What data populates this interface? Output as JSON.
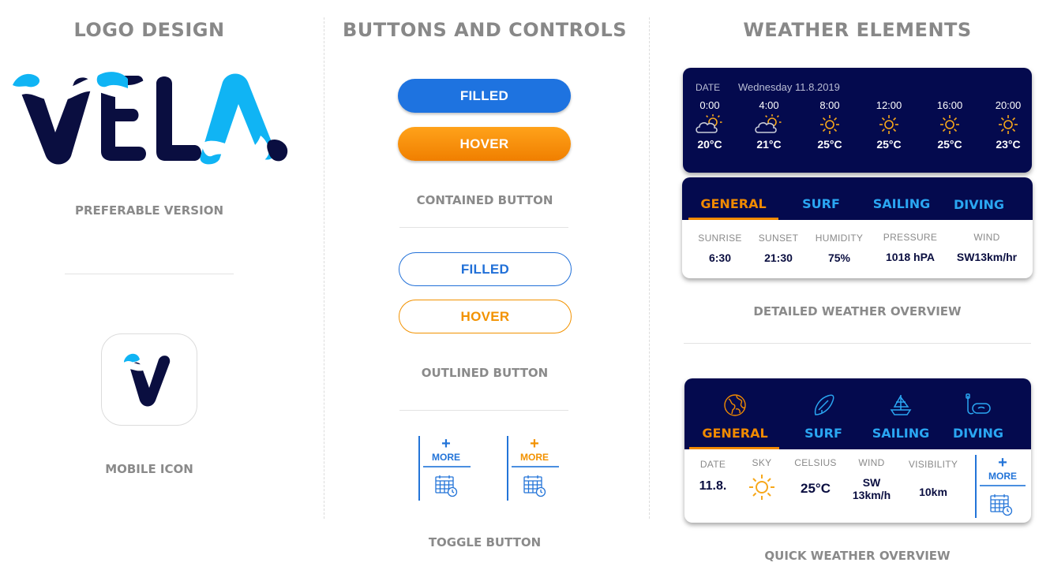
{
  "sections": {
    "logo": "LOGO DESIGN",
    "buttons": "BUTTONS AND CONTROLS",
    "weather": "WEATHER ELEMENTS"
  },
  "captions": {
    "preferable": "PREFERABLE VERSION",
    "mobile": "MOBILE ICON",
    "contained": "CONTAINED BUTTON",
    "outlined": "OUTLINED BUTTON",
    "toggle": "TOGGLE BUTTON",
    "detailed": "DETAILED WEATHER OVERVIEW",
    "quick": "QUICK WEATHER OVERVIEW"
  },
  "logo": {
    "text": "VELA",
    "colors": {
      "dark": "#0a0e40",
      "light": "#10b4f4"
    }
  },
  "buttons": {
    "contained_filled": "FILLED",
    "contained_hover": "HOVER",
    "outlined_filled": "FILLED",
    "outlined_hover": "HOVER",
    "toggle_plus": "+",
    "toggle_more": "MORE"
  },
  "forecast": {
    "date_label": "DATE",
    "date": "Wednesday 11.8.2019",
    "items": [
      {
        "time": "0:00",
        "icon": "partly-cloudy-icon",
        "temp": "20°C"
      },
      {
        "time": "4:00",
        "icon": "partly-cloudy-icon",
        "temp": "21°C"
      },
      {
        "time": "8:00",
        "icon": "sun-icon",
        "temp": "25°C"
      },
      {
        "time": "12:00",
        "icon": "sun-icon",
        "temp": "25°C"
      },
      {
        "time": "16:00",
        "icon": "sun-icon",
        "temp": "25°C"
      },
      {
        "time": "20:00",
        "icon": "sun-icon",
        "temp": "23°C"
      }
    ]
  },
  "detailed": {
    "tabs": [
      "GENERAL",
      "SURF",
      "SAILING",
      "DIVING"
    ],
    "stats": [
      {
        "label": "SUNRISE",
        "value": "6:30"
      },
      {
        "label": "SUNSET",
        "value": "21:30"
      },
      {
        "label": "HUMIDITY",
        "value": "75%"
      },
      {
        "label": "PRESSURE",
        "value": "1018 hPA"
      },
      {
        "label": "WIND",
        "value": "SW13km/hr"
      }
    ]
  },
  "quick": {
    "tabs": [
      {
        "label": "GENERAL",
        "icon": "globe-icon"
      },
      {
        "label": "SURF",
        "icon": "surfboard-icon"
      },
      {
        "label": "SAILING",
        "icon": "sailboat-icon"
      },
      {
        "label": "DIVING",
        "icon": "diving-mask-icon"
      }
    ],
    "stats": {
      "date_label": "DATE",
      "date": "11.8.",
      "sky_label": "SKY",
      "celsius_label": "CELSIUS",
      "celsius": "25°C",
      "wind_label": "WIND",
      "wind_dir": "SW",
      "wind_speed": "13km/h",
      "visibility_label": "VISIBILITY",
      "visibility": "10km"
    },
    "more_plus": "+",
    "more": "MORE"
  },
  "colors": {
    "navy": "#040a4e",
    "blue": "#1e73e0",
    "orange": "#f08a00",
    "sky": "#2aa6f2"
  }
}
